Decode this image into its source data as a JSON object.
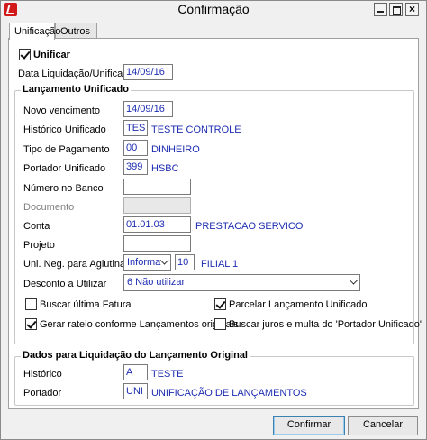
{
  "window": {
    "title": "Confirmação"
  },
  "tabs": [
    {
      "label": "Unificação"
    },
    {
      "label": "Outros"
    }
  ],
  "unificar": {
    "label": "Unificar",
    "checked": true
  },
  "data_liquidacao": {
    "label": "Data Liquidação/Unificação",
    "value": "14/09/16"
  },
  "lancamento": {
    "title": "Lançamento Unificado",
    "novo_vencimento": {
      "label": "Novo vencimento",
      "value": "14/09/16"
    },
    "historico": {
      "label": "Histórico Unificado",
      "code": "TES",
      "desc": "TESTE CONTROLE"
    },
    "tipo_pagamento": {
      "label": "Tipo de Pagamento",
      "code": "00",
      "desc": "DINHEIRO"
    },
    "portador": {
      "label": "Portador Unificado",
      "code": "399",
      "desc": "HSBC"
    },
    "numero_banco": {
      "label": "Número no Banco",
      "value": ""
    },
    "documento": {
      "label": "Documento",
      "value": ""
    },
    "conta": {
      "label": "Conta",
      "code": "01.01.03",
      "desc": "PRESTACAO SERVICO"
    },
    "projeto": {
      "label": "Projeto",
      "value": ""
    },
    "uni_neg": {
      "label": "Uni. Neg. para Aglutinação",
      "select": "Informa",
      "code": "10",
      "desc": "FILIAL 1"
    },
    "desconto": {
      "label": "Desconto a Utilizar",
      "select": "6 Não utilizar"
    },
    "checks": {
      "buscar_fatura": {
        "label": "Buscar última Fatura",
        "checked": false
      },
      "parcelar": {
        "label": "Parcelar Lançamento Unificado",
        "checked": true
      },
      "gerar_rateio": {
        "label": "Gerar rateio conforme Lançamentos originais",
        "checked": true
      },
      "buscar_juros": {
        "label": "Buscar juros e multa do 'Portador Unificado'",
        "checked": false
      }
    }
  },
  "liquidacao": {
    "title": "Dados para Liquidação do Lançamento Original",
    "historico": {
      "label": "Histórico",
      "code": "A",
      "desc": "TESTE"
    },
    "portador": {
      "label": "Portador",
      "code": "UNI",
      "desc": "UNIFICAÇÃO DE LANÇAMENTOS"
    }
  },
  "buttons": {
    "confirm": "Confirmar",
    "cancel": "Cancelar"
  }
}
